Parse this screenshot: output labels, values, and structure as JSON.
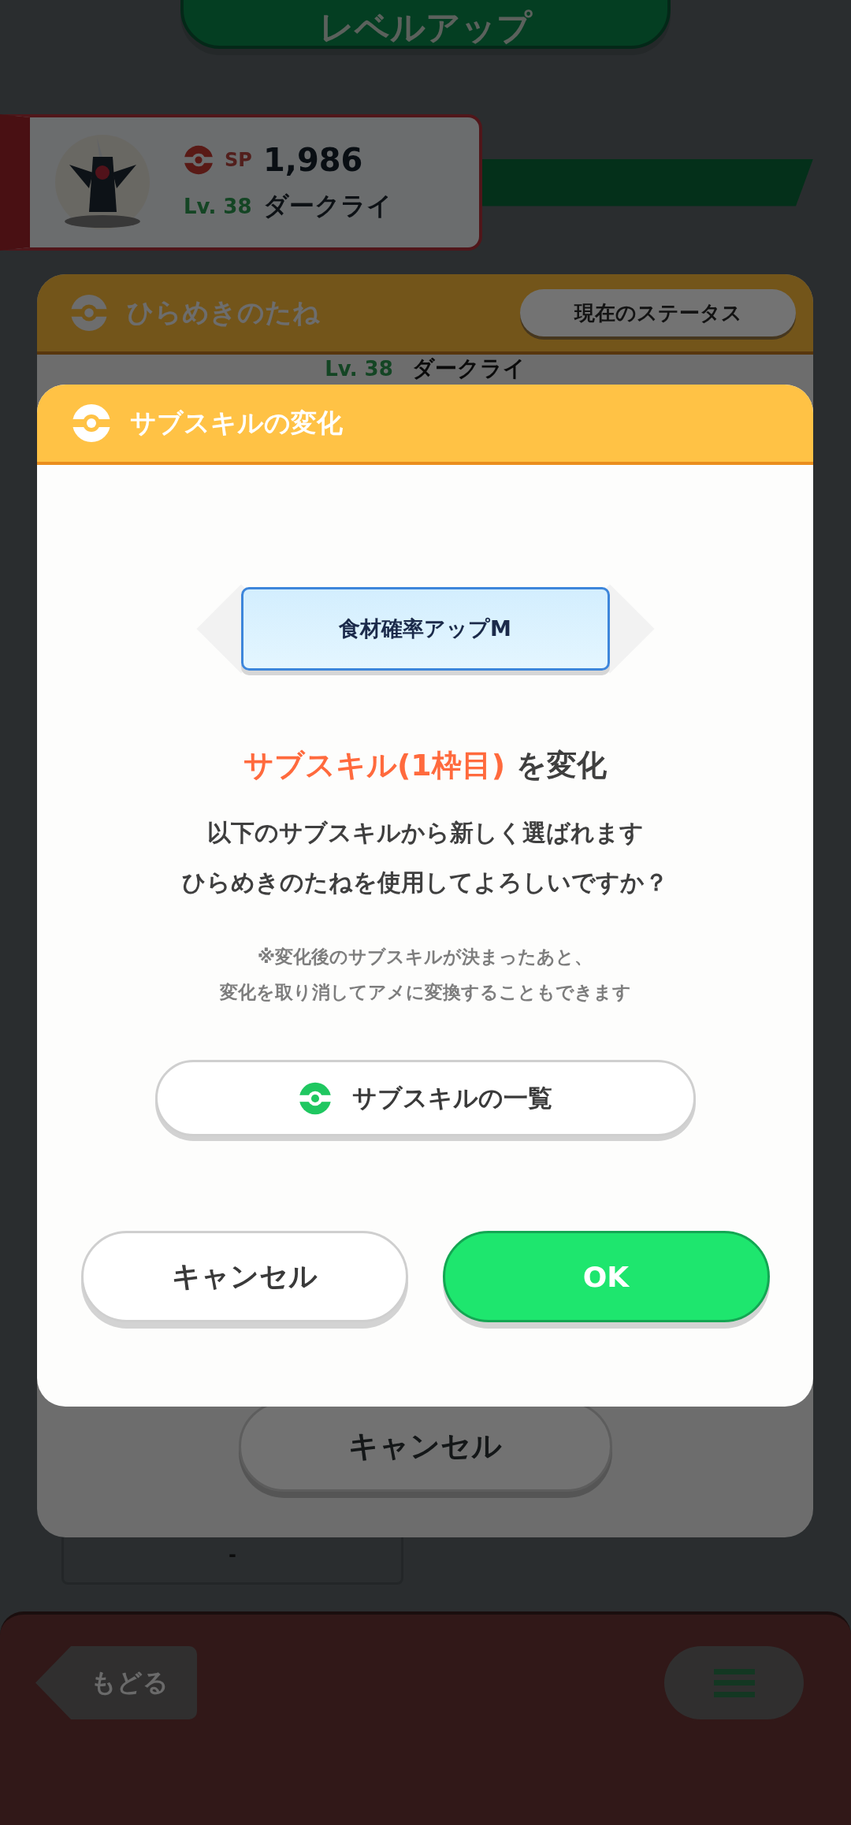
{
  "top_button": {
    "label": "レベルアップ"
  },
  "pokemon_card": {
    "sp_label": "SP",
    "sp_value": "1,986",
    "level": "Lv. 38",
    "name": "ダークライ"
  },
  "panel": {
    "title": "ひらめきのたね",
    "status_button": "現在のステータス",
    "level": "Lv. 38",
    "name": "ダークライ",
    "cancel_button": "キャンセル",
    "field_value": "-"
  },
  "dialog": {
    "title": "サブスキルの変化",
    "current_skill": "食材確率アップM",
    "heading": [
      {
        "text": "サブスキル(1枠目)",
        "kind": "highlight"
      },
      {
        "text": "を変化",
        "kind": "normal"
      }
    ],
    "message_lines": [
      "以下のサブスキルから新しく選ばれます",
      "ひらめきのたねを使用してよろしいですか？"
    ],
    "note_lines": [
      "※変化後のサブスキルが決まったあと、",
      "変化を取り消してアメに変換することもできます"
    ],
    "list_button": "サブスキルの一覧",
    "buttons": [
      {
        "label": "キャンセル",
        "kind": "secondary"
      },
      {
        "label": "OK",
        "kind": "primary"
      }
    ]
  },
  "bottom_bar": {
    "back_button": "もどる"
  }
}
